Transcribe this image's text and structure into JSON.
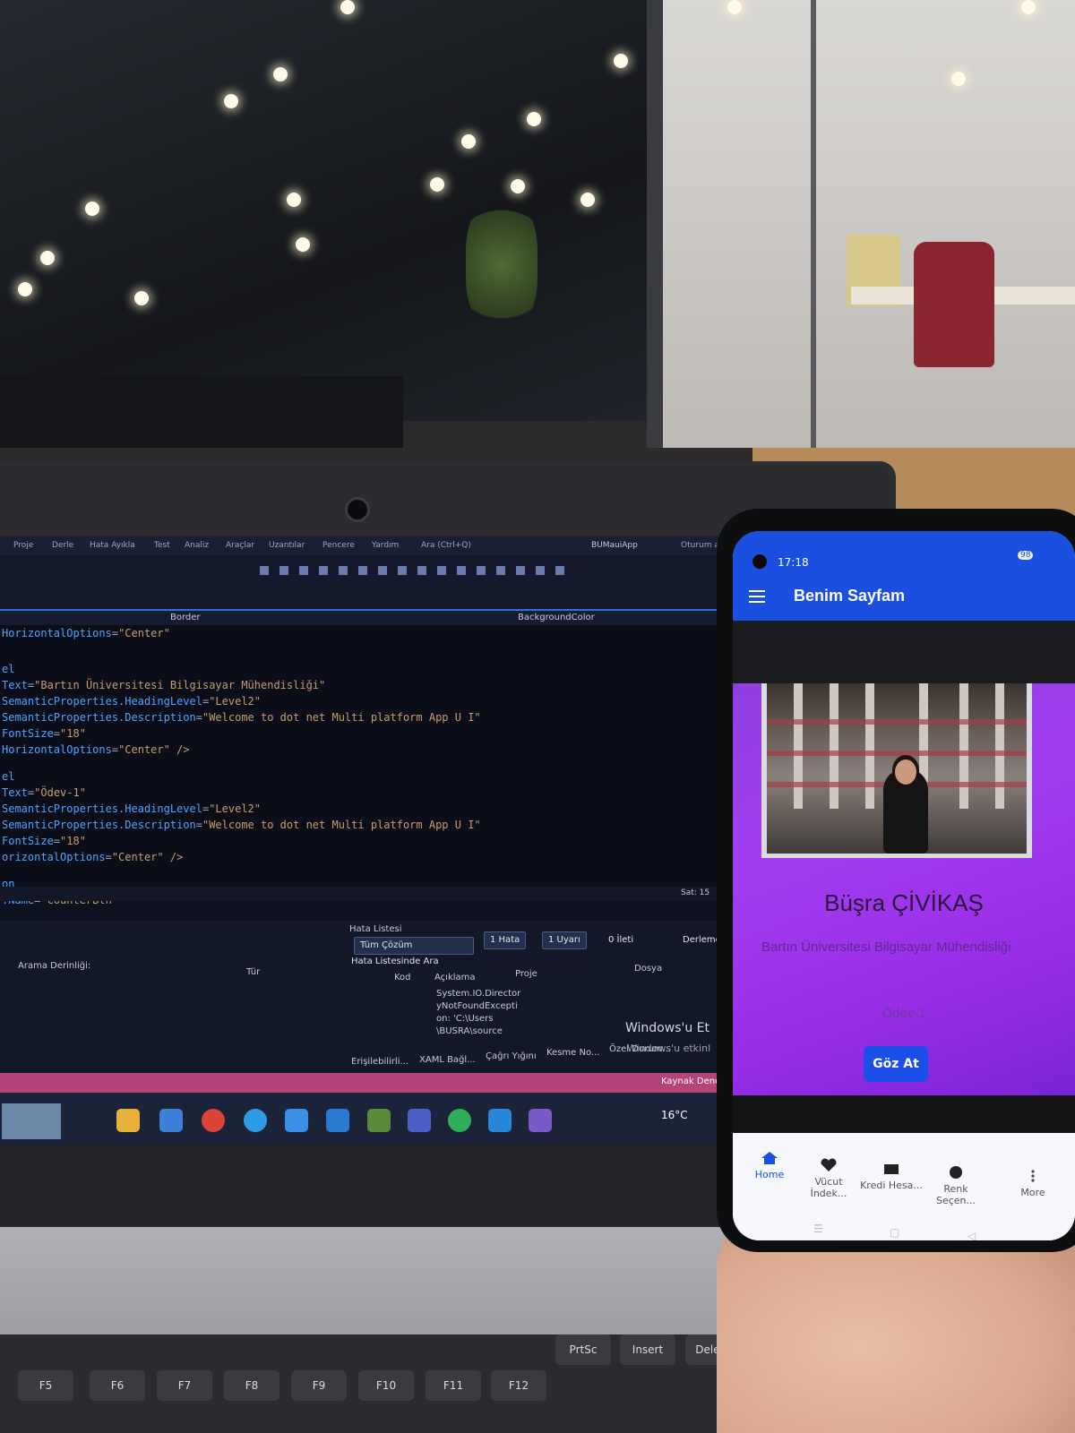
{
  "laptop": {
    "menu": [
      "Proje",
      "Derle",
      "Hata Ayıkla",
      "Test",
      "Analiz",
      "Araçlar",
      "Uzantılar",
      "Pencere",
      "Yardım",
      "Ara (Ctrl+Q)",
      "BUMauiApp",
      "Oturum aç"
    ],
    "tabs": {
      "left": "Border",
      "right": "BackgroundColor"
    },
    "code_lines": [
      {
        "key": "HorizontalOptions",
        "val": "\"Center\""
      },
      {
        "key": "el",
        "val": ""
      },
      {
        "key": "Text",
        "val": "\"Bartın Üniversitesi Bilgisayar Mühendisliği\""
      },
      {
        "key": "SemanticProperties.HeadingLevel",
        "val": "\"Level2\""
      },
      {
        "key": "SemanticProperties.Description",
        "val": "\"Welcome to dot net Multi platform App U I\""
      },
      {
        "key": "FontSize",
        "val": "\"18\""
      },
      {
        "key": "HorizontalOptions",
        "val": "\"Center\" />"
      },
      {
        "key": "el",
        "val": ""
      },
      {
        "key": "Text",
        "val": "\"Ödev-1\""
      },
      {
        "key": "SemanticProperties.HeadingLevel",
        "val": "\"Level2\""
      },
      {
        "key": "SemanticProperties.Description",
        "val": "\"Welcome to dot net Multi platform App U I\""
      },
      {
        "key": "FontSize",
        "val": "\"18\""
      },
      {
        "key": "orizontalOptions",
        "val": "\"Center\" />"
      },
      {
        "key": "on",
        "val": ""
      },
      {
        "key": ":Name",
        "val": "\"CounterBtn\""
      }
    ],
    "line_indicator": "Sat: 15",
    "error_list": {
      "title": "Hata Listesi",
      "scope": "Tüm Çözüm",
      "errors": "1 Hata",
      "warnings": "1 Uyarı",
      "messages": "0 İleti",
      "build": "Derleme",
      "search": "Hata Listesinde Ara",
      "columns": [
        "Kod",
        "Açıklama",
        "Proje",
        "Dosya"
      ],
      "description": [
        "System.IO.Director",
        "yNotFoundExcepti",
        "on: 'C:\\Users",
        "\\BUSRA\\source"
      ],
      "left_panel": [
        "Arama Derinliği:",
        "Tür"
      ]
    },
    "bottom_tabs": [
      "Erişilebilirli...",
      "XAML Bağl...",
      "Çağrı Yığını",
      "Kesme No...",
      "Özel Durum..."
    ],
    "watermark": [
      "Windows'u Et",
      "Windows'u etkinl"
    ],
    "status_right": "Kaynak Dene",
    "weather": "16°C"
  },
  "phone": {
    "time": "17:18",
    "battery": "98",
    "app_title": "Benim Sayfam",
    "name": "Büşra ÇİVİKAŞ",
    "university": "Bartın Üniversitesi Bilgisayar Mühendisliği",
    "assignment": "Ödev-1",
    "button": "Göz At",
    "tabs": [
      {
        "label": "Home",
        "icon": "home-icon"
      },
      {
        "label": "Vücut İndek...",
        "icon": "heart-icon"
      },
      {
        "label": "Kredi Hesa...",
        "icon": "card-icon"
      },
      {
        "label": "Renk Seçen...",
        "icon": "palette-icon"
      },
      {
        "label": "More",
        "icon": "more-icon"
      }
    ]
  },
  "keyboard": {
    "keys": [
      "F5",
      "F6",
      "F7",
      "F8",
      "F9",
      "F10",
      "F11",
      "F12",
      "PrtSc",
      "Insert",
      "Delete"
    ]
  },
  "colors": {
    "app_bar": "#1a4fe0",
    "content_purple": "#a33ef0",
    "vs_statusbar": "#b34479"
  }
}
